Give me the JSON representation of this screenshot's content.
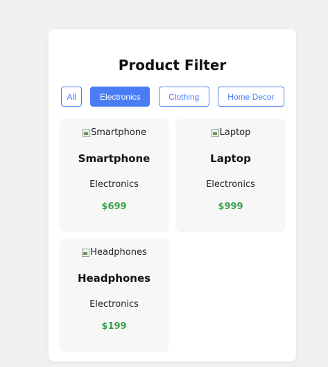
{
  "title": "Product Filter",
  "filters": [
    {
      "label": "All",
      "active": false
    },
    {
      "label": "Electronics",
      "active": true
    },
    {
      "label": "Clothing",
      "active": false
    },
    {
      "label": "Home Decor",
      "active": false
    }
  ],
  "products": [
    {
      "image_alt": "Smartphone",
      "name": "Smartphone",
      "category": "Electronics",
      "price": "$699"
    },
    {
      "image_alt": "Laptop",
      "name": "Laptop",
      "category": "Electronics",
      "price": "$999"
    },
    {
      "image_alt": "Headphones",
      "name": "Headphones",
      "category": "Electronics",
      "price": "$199"
    }
  ],
  "colors": {
    "accent": "#4a7cf5",
    "price": "#3aa04a",
    "background": "#f0f0f0",
    "card": "#ffffff",
    "product_card": "#f7f7f7"
  }
}
